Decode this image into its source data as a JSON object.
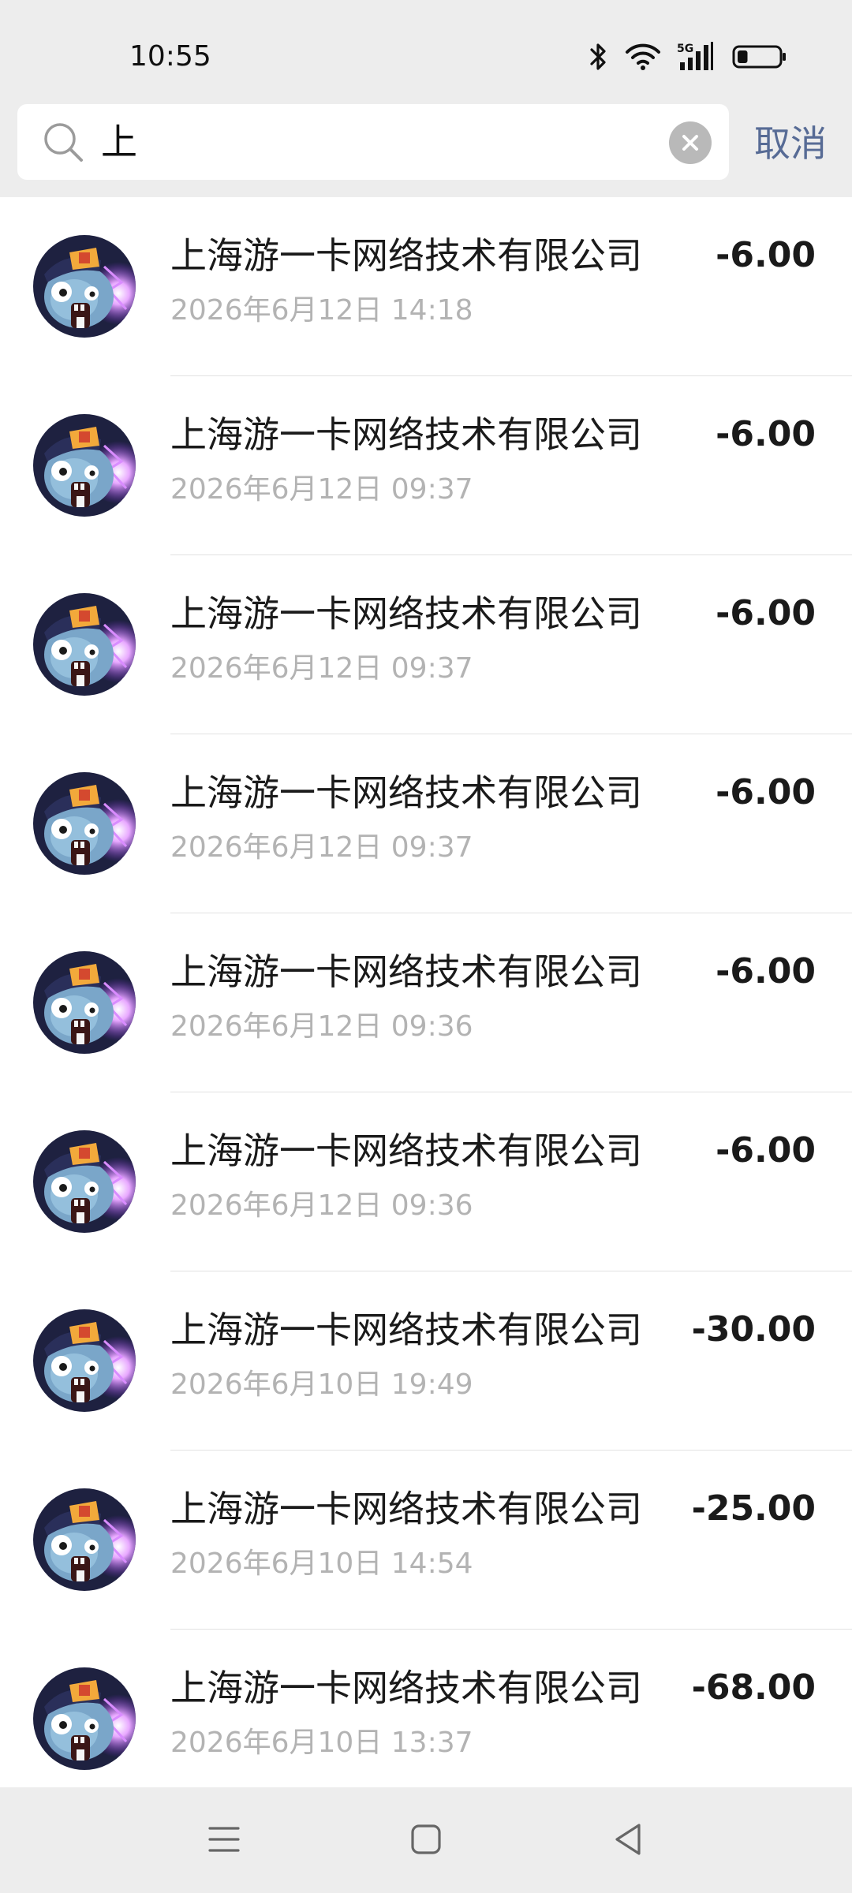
{
  "status_bar": {
    "time": "10:55",
    "icons": [
      "bluetooth-icon",
      "wifi-icon",
      "5g-signal-icon",
      "battery-icon"
    ],
    "network_label": "5G",
    "battery_level": 0.25
  },
  "search": {
    "query": "上",
    "cancel_label": "取消"
  },
  "transactions": [
    {
      "merchant": "上海游一卡网络技术有限公司",
      "time": "2026年6月12日 14:18",
      "amount": "-6.00"
    },
    {
      "merchant": "上海游一卡网络技术有限公司",
      "time": "2026年6月12日 09:37",
      "amount": "-6.00"
    },
    {
      "merchant": "上海游一卡网络技术有限公司",
      "time": "2026年6月12日 09:37",
      "amount": "-6.00"
    },
    {
      "merchant": "上海游一卡网络技术有限公司",
      "time": "2026年6月12日 09:37",
      "amount": "-6.00"
    },
    {
      "merchant": "上海游一卡网络技术有限公司",
      "time": "2026年6月12日 09:36",
      "amount": "-6.00"
    },
    {
      "merchant": "上海游一卡网络技术有限公司",
      "time": "2026年6月12日 09:36",
      "amount": "-6.00"
    },
    {
      "merchant": "上海游一卡网络技术有限公司",
      "time": "2026年6月10日 19:49",
      "amount": "-30.00"
    },
    {
      "merchant": "上海游一卡网络技术有限公司",
      "time": "2026年6月10日 14:54",
      "amount": "-25.00"
    },
    {
      "merchant": "上海游一卡网络技术有限公司",
      "time": "2026年6月10日 13:37",
      "amount": "-68.00"
    }
  ],
  "colors": {
    "header_bg": "#ededed",
    "cancel_text": "#576b95",
    "secondary_text": "#b3b3b3",
    "avatar_glow": "#b84dff"
  },
  "nav": [
    "menu-icon",
    "home-icon",
    "back-icon"
  ]
}
